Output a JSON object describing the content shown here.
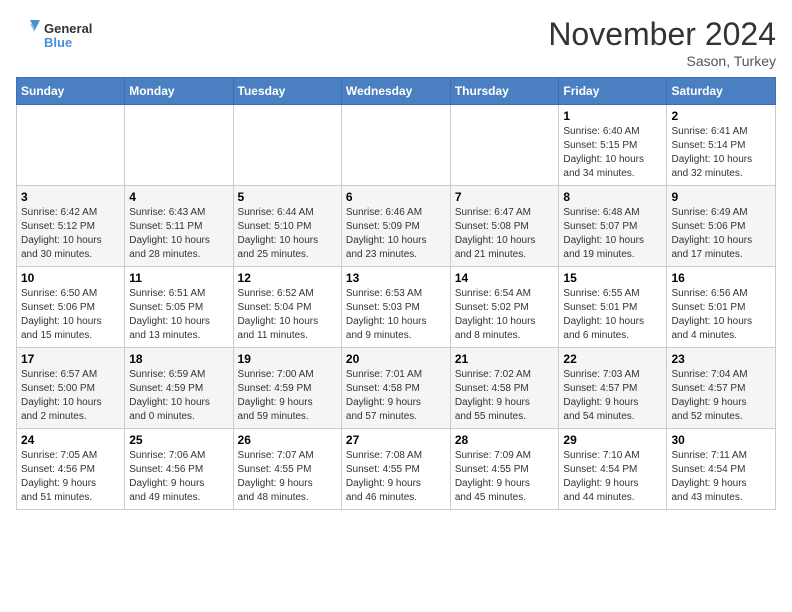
{
  "logo": {
    "general": "General",
    "blue": "Blue"
  },
  "title": "November 2024",
  "location": "Sason, Turkey",
  "days_header": [
    "Sunday",
    "Monday",
    "Tuesday",
    "Wednesday",
    "Thursday",
    "Friday",
    "Saturday"
  ],
  "weeks": [
    [
      {
        "day": "",
        "info": ""
      },
      {
        "day": "",
        "info": ""
      },
      {
        "day": "",
        "info": ""
      },
      {
        "day": "",
        "info": ""
      },
      {
        "day": "",
        "info": ""
      },
      {
        "day": "1",
        "info": "Sunrise: 6:40 AM\nSunset: 5:15 PM\nDaylight: 10 hours\nand 34 minutes."
      },
      {
        "day": "2",
        "info": "Sunrise: 6:41 AM\nSunset: 5:14 PM\nDaylight: 10 hours\nand 32 minutes."
      }
    ],
    [
      {
        "day": "3",
        "info": "Sunrise: 6:42 AM\nSunset: 5:12 PM\nDaylight: 10 hours\nand 30 minutes."
      },
      {
        "day": "4",
        "info": "Sunrise: 6:43 AM\nSunset: 5:11 PM\nDaylight: 10 hours\nand 28 minutes."
      },
      {
        "day": "5",
        "info": "Sunrise: 6:44 AM\nSunset: 5:10 PM\nDaylight: 10 hours\nand 25 minutes."
      },
      {
        "day": "6",
        "info": "Sunrise: 6:46 AM\nSunset: 5:09 PM\nDaylight: 10 hours\nand 23 minutes."
      },
      {
        "day": "7",
        "info": "Sunrise: 6:47 AM\nSunset: 5:08 PM\nDaylight: 10 hours\nand 21 minutes."
      },
      {
        "day": "8",
        "info": "Sunrise: 6:48 AM\nSunset: 5:07 PM\nDaylight: 10 hours\nand 19 minutes."
      },
      {
        "day": "9",
        "info": "Sunrise: 6:49 AM\nSunset: 5:06 PM\nDaylight: 10 hours\nand 17 minutes."
      }
    ],
    [
      {
        "day": "10",
        "info": "Sunrise: 6:50 AM\nSunset: 5:06 PM\nDaylight: 10 hours\nand 15 minutes."
      },
      {
        "day": "11",
        "info": "Sunrise: 6:51 AM\nSunset: 5:05 PM\nDaylight: 10 hours\nand 13 minutes."
      },
      {
        "day": "12",
        "info": "Sunrise: 6:52 AM\nSunset: 5:04 PM\nDaylight: 10 hours\nand 11 minutes."
      },
      {
        "day": "13",
        "info": "Sunrise: 6:53 AM\nSunset: 5:03 PM\nDaylight: 10 hours\nand 9 minutes."
      },
      {
        "day": "14",
        "info": "Sunrise: 6:54 AM\nSunset: 5:02 PM\nDaylight: 10 hours\nand 8 minutes."
      },
      {
        "day": "15",
        "info": "Sunrise: 6:55 AM\nSunset: 5:01 PM\nDaylight: 10 hours\nand 6 minutes."
      },
      {
        "day": "16",
        "info": "Sunrise: 6:56 AM\nSunset: 5:01 PM\nDaylight: 10 hours\nand 4 minutes."
      }
    ],
    [
      {
        "day": "17",
        "info": "Sunrise: 6:57 AM\nSunset: 5:00 PM\nDaylight: 10 hours\nand 2 minutes."
      },
      {
        "day": "18",
        "info": "Sunrise: 6:59 AM\nSunset: 4:59 PM\nDaylight: 10 hours\nand 0 minutes."
      },
      {
        "day": "19",
        "info": "Sunrise: 7:00 AM\nSunset: 4:59 PM\nDaylight: 9 hours\nand 59 minutes."
      },
      {
        "day": "20",
        "info": "Sunrise: 7:01 AM\nSunset: 4:58 PM\nDaylight: 9 hours\nand 57 minutes."
      },
      {
        "day": "21",
        "info": "Sunrise: 7:02 AM\nSunset: 4:58 PM\nDaylight: 9 hours\nand 55 minutes."
      },
      {
        "day": "22",
        "info": "Sunrise: 7:03 AM\nSunset: 4:57 PM\nDaylight: 9 hours\nand 54 minutes."
      },
      {
        "day": "23",
        "info": "Sunrise: 7:04 AM\nSunset: 4:57 PM\nDaylight: 9 hours\nand 52 minutes."
      }
    ],
    [
      {
        "day": "24",
        "info": "Sunrise: 7:05 AM\nSunset: 4:56 PM\nDaylight: 9 hours\nand 51 minutes."
      },
      {
        "day": "25",
        "info": "Sunrise: 7:06 AM\nSunset: 4:56 PM\nDaylight: 9 hours\nand 49 minutes."
      },
      {
        "day": "26",
        "info": "Sunrise: 7:07 AM\nSunset: 4:55 PM\nDaylight: 9 hours\nand 48 minutes."
      },
      {
        "day": "27",
        "info": "Sunrise: 7:08 AM\nSunset: 4:55 PM\nDaylight: 9 hours\nand 46 minutes."
      },
      {
        "day": "28",
        "info": "Sunrise: 7:09 AM\nSunset: 4:55 PM\nDaylight: 9 hours\nand 45 minutes."
      },
      {
        "day": "29",
        "info": "Sunrise: 7:10 AM\nSunset: 4:54 PM\nDaylight: 9 hours\nand 44 minutes."
      },
      {
        "day": "30",
        "info": "Sunrise: 7:11 AM\nSunset: 4:54 PM\nDaylight: 9 hours\nand 43 minutes."
      }
    ]
  ]
}
